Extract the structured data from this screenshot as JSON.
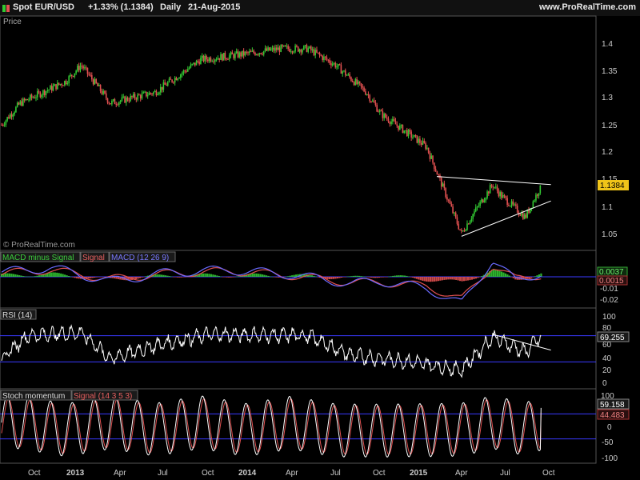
{
  "header": {
    "instrument": "Spot EUR/USD",
    "change": "+1.33% (1.1384)",
    "period": "Daily",
    "date": "21-Aug-2015",
    "site": "www.ProRealTime.com",
    "up_color": "#32c832",
    "down_color": "#e05050"
  },
  "price_panel": {
    "label": "Price",
    "watermark": "© ProRealTime.com",
    "y_ticks": [
      "1.4",
      "1.35",
      "1.3",
      "1.25",
      "1.2",
      "1.15",
      "1.1",
      "1.05"
    ],
    "last_value": "1.1384"
  },
  "macd_panel": {
    "label_hist": "MACD minus Signal",
    "label_signal": "Signal",
    "label_macd": "MACD (12 26 9)",
    "y_ticks": [
      "0",
      "-0.01",
      "-0.02"
    ],
    "value_macd": "0.0037",
    "value_signal": "0.0015"
  },
  "rsi_panel": {
    "label": "RSI (14)",
    "y_ticks": [
      "100",
      "80",
      "60",
      "40",
      "20",
      "0"
    ],
    "value": "69.255"
  },
  "stoch_panel": {
    "label": "Stoch momentum",
    "label_signal": "Signal (14 3 5 3)",
    "y_ticks": [
      "100",
      "50",
      "0",
      "-50",
      "-100"
    ],
    "value_main": "59.158",
    "value_signal": "44.483"
  },
  "x_axis": {
    "labels": [
      "Oct",
      "2013",
      "Apr",
      "Jul",
      "Oct",
      "2014",
      "Apr",
      "Jul",
      "Oct",
      "2015",
      "Apr",
      "Jul",
      "Oct"
    ]
  },
  "chart_data": [
    {
      "type": "candlestick",
      "title": "Spot EUR/USD Daily",
      "x": [
        "2012-08-24",
        "2012-10-01",
        "2013-01-01",
        "2013-02-01",
        "2013-04-01",
        "2013-07-01",
        "2013-10-01",
        "2013-12-27",
        "2014-03-13",
        "2014-05-06",
        "2014-07-01",
        "2014-09-01",
        "2014-10-01",
        "2015-01-01",
        "2015-03-13",
        "2015-04-01",
        "2015-05-15",
        "2015-06-01",
        "2015-07-20",
        "2015-08-21"
      ],
      "close": [
        1.25,
        1.29,
        1.33,
        1.36,
        1.29,
        1.31,
        1.37,
        1.38,
        1.39,
        1.39,
        1.36,
        1.31,
        1.27,
        1.21,
        1.05,
        1.08,
        1.14,
        1.12,
        1.08,
        1.1384
      ],
      "ylim": [
        1.02,
        1.44
      ],
      "trendlines": [
        {
          "from": [
            "2015-01-22",
            1.155
          ],
          "to": [
            "2015-09-10",
            1.14
          ]
        },
        {
          "from": [
            "2015-03-13",
            1.045
          ],
          "to": [
            "2015-09-10",
            1.11
          ]
        }
      ]
    },
    {
      "type": "line",
      "title": "MACD (12 26 9)",
      "x": [
        "2012-08-24",
        "2012-12-01",
        "2013-04-01",
        "2013-08-01",
        "2013-12-01",
        "2014-04-01",
        "2014-08-01",
        "2014-10-01",
        "2015-01-01",
        "2015-03-13",
        "2015-05-15",
        "2015-07-01",
        "2015-08-21"
      ],
      "series": [
        {
          "name": "MACD (12 26 9)",
          "values": [
            0.004,
            0.008,
            -0.004,
            0.004,
            0.006,
            0.002,
            -0.006,
            -0.004,
            -0.01,
            -0.024,
            0.015,
            -0.004,
            0.0037
          ]
        },
        {
          "name": "Signal",
          "values": [
            0.003,
            0.006,
            -0.002,
            0.003,
            0.005,
            0.001,
            -0.005,
            -0.005,
            -0.008,
            -0.02,
            0.01,
            -0.002,
            0.0015
          ]
        }
      ],
      "ylim": [
        -0.028,
        0.025
      ]
    },
    {
      "type": "line",
      "title": "RSI (14)",
      "x": [
        "2012-08-24",
        "2012-10-15",
        "2013-02-01",
        "2013-04-01",
        "2013-07-01",
        "2013-10-20",
        "2014-05-06",
        "2014-08-01",
        "2014-12-01",
        "2015-03-13",
        "2015-05-15",
        "2015-07-20",
        "2015-08-21"
      ],
      "values": [
        35,
        70,
        75,
        35,
        55,
        72,
        70,
        40,
        30,
        18,
        68,
        45,
        69.255
      ],
      "ylim": [
        0,
        100
      ],
      "guides": [
        70,
        30
      ],
      "trendline": {
        "from": [
          "2015-05-15",
          72
        ],
        "to": [
          "2015-09-10",
          48
        ]
      }
    },
    {
      "type": "line",
      "title": "Stoch momentum",
      "x": [
        "2012-08-24",
        "2012-10-01",
        "2013-01-01",
        "2013-04-01",
        "2013-07-01",
        "2013-10-01",
        "2014-01-01",
        "2014-04-01",
        "2014-07-01",
        "2014-10-01",
        "2015-01-01",
        "2015-03-13",
        "2015-05-15",
        "2015-07-20",
        "2015-08-21"
      ],
      "series": [
        {
          "name": "Stoch momentum",
          "values": [
            80,
            90,
            -80,
            85,
            -70,
            90,
            -75,
            80,
            -85,
            -90,
            -80,
            -70,
            90,
            -60,
            59.158
          ]
        },
        {
          "name": "Signal (14 3 5 3)",
          "values": [
            70,
            80,
            -70,
            75,
            -60,
            80,
            -65,
            70,
            -75,
            -80,
            -70,
            -60,
            80,
            -55,
            44.483
          ]
        }
      ],
      "ylim": [
        -105,
        105
      ],
      "guides": [
        40,
        -40
      ]
    }
  ]
}
